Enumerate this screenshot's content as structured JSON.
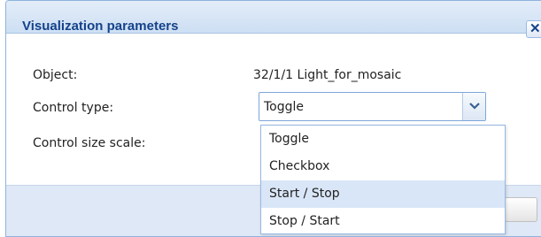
{
  "dialog": {
    "title": "Visualization parameters",
    "close_glyph": "✕"
  },
  "form": {
    "object_label": "Object:",
    "object_value": "32/1/1 Light_for_mosaic",
    "control_type_label": "Control type:",
    "control_type_value": "Toggle",
    "control_size_label": "Control size scale:"
  },
  "dropdown": {
    "options": [
      "Toggle",
      "Checkbox",
      "Start / Stop",
      "Stop / Start"
    ],
    "highlighted_index": 2
  },
  "icons": {
    "close": "close-icon",
    "combo_trigger": "chevron-down-icon"
  },
  "colors": {
    "title_text": "#15428b",
    "titlebar_bg": "#d6e4f5",
    "highlight": "#d9e6f7",
    "footer_bg": "#dfe8f6"
  }
}
